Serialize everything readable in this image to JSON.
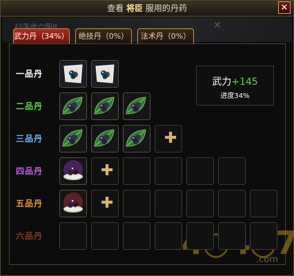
{
  "window": {
    "title_prefix": "查看",
    "title_name": "将臣",
    "title_suffix": "服用的丹药",
    "close_label": "✕"
  },
  "background": {
    "ghost_text": "扫荡虎穴图8",
    "ghost_close": "✕"
  },
  "tabs": [
    {
      "label": "武力丹（34%）",
      "active": true
    },
    {
      "label": "绝技丹（0%）",
      "active": false
    },
    {
      "label": "法术丹（0%）",
      "active": false
    }
  ],
  "rows": [
    {
      "label": "一品丹",
      "color": "#ffffff",
      "pills": 2,
      "plus": false
    },
    {
      "label": "二品丹",
      "color": "#5ed84a",
      "pills": 3,
      "plus": false
    },
    {
      "label": "三品丹",
      "color": "#6ab8ff",
      "pills": 3,
      "plus": true
    },
    {
      "label": "四品丹",
      "color": "#c860e8",
      "pills": 1,
      "plus": true
    },
    {
      "label": "五品丹",
      "color": "#e89a2a",
      "pills": 1,
      "plus": true
    },
    {
      "label": "六品丹",
      "color": "#8a3a22",
      "pills": 0,
      "plus": false
    }
  ],
  "stat": {
    "name": "武力",
    "bonus": "+145",
    "progress": "进度34%"
  },
  "watermark": {
    "number": "4○4○7",
    "domain": ".com"
  },
  "icons": {
    "close": "close-icon",
    "plus": "plus-icon",
    "pill": "pill-icon"
  }
}
